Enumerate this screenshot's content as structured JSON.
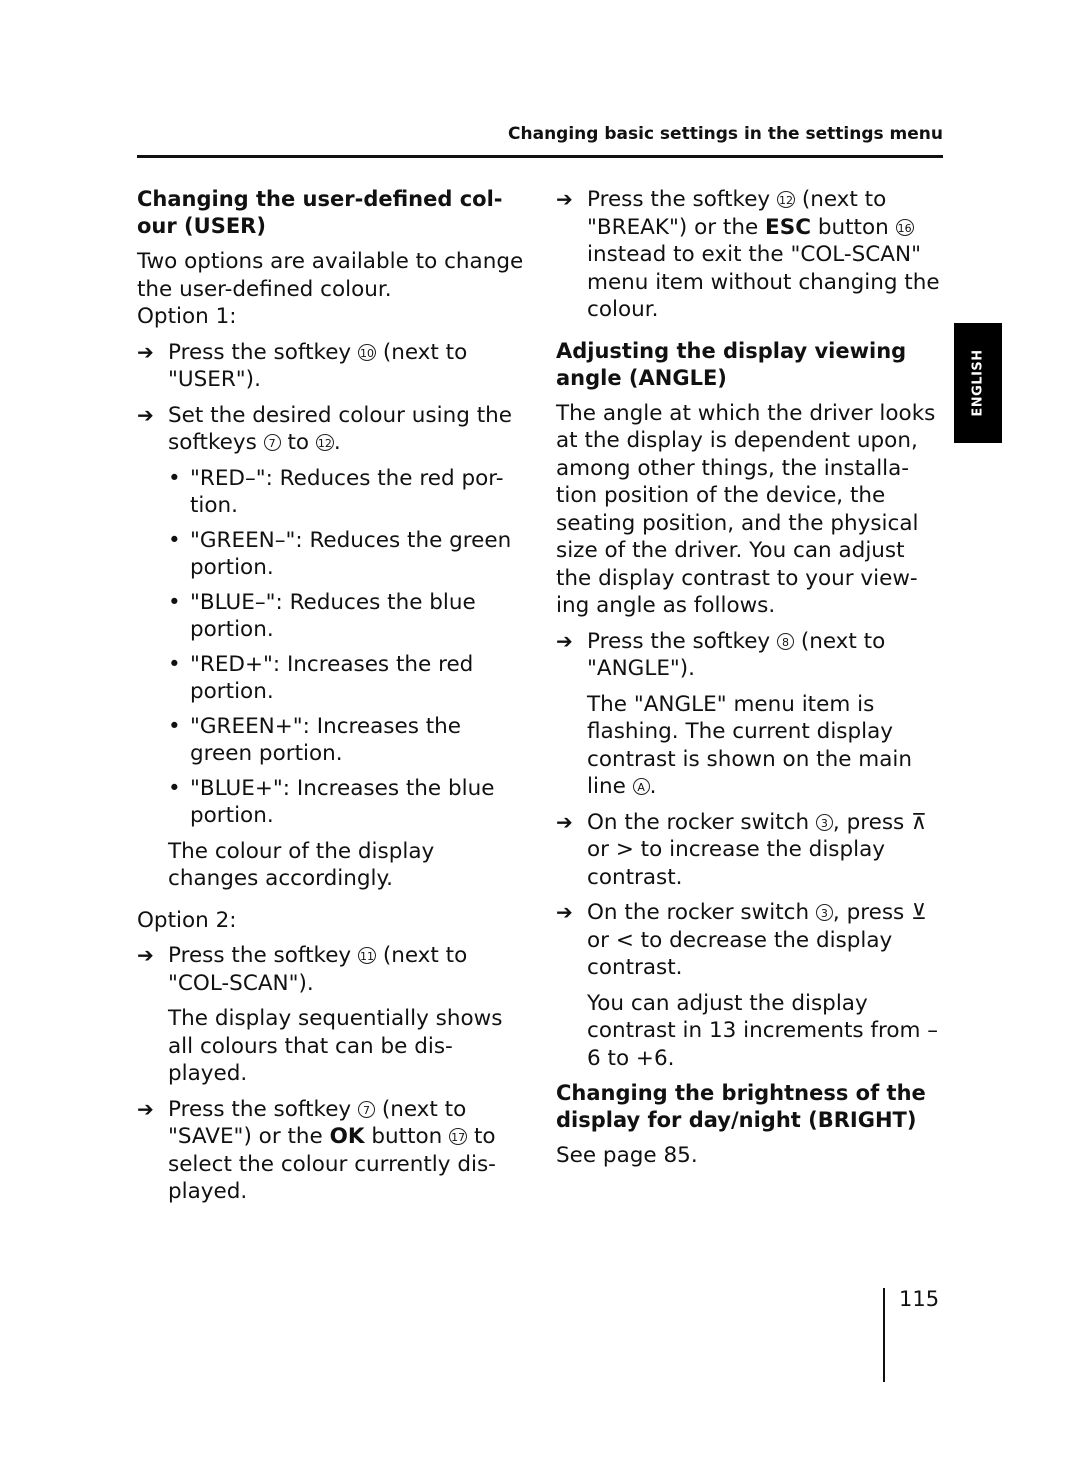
{
  "header": {
    "running_title": "Changing basic settings in the settings menu"
  },
  "side_tab": {
    "label": "ENGLISH"
  },
  "footer": {
    "page_number": "115"
  },
  "left_column": {
    "heading": "Changing the user-defined col- our (USER)",
    "intro": "Two options are available to change the user-defined colour.",
    "option1_label": "Option 1:",
    "step1": {
      "prefix": "Press the softkey ",
      "key": "10",
      "suffix": " (next to \"USER\")."
    },
    "step2": {
      "prefix": "Set the desired colour using the softkeys ",
      "key_from": "7",
      "middle": " to ",
      "key_to": "12",
      "suffix": "."
    },
    "bullets": [
      "\"RED–\": Reduces the red por- tion.",
      "\"GREEN–\": Reduces the green portion.",
      "\"BLUE–\": Reduces the blue portion.",
      "\"RED+\": Increases the red portion.",
      "\"GREEN+\": Increases the green portion.",
      "\"BLUE+\": Increases the blue portion."
    ],
    "result1": "The colour of the display changes accordingly.",
    "option2_label": "Option 2:",
    "step3": {
      "prefix": "Press the softkey ",
      "key": "11",
      "suffix": " (next to \"COL-SCAN\")."
    },
    "result2": "The display sequentially shows all colours that can be dis- played.",
    "step4": {
      "prefix": "Press the softkey ",
      "key": "7",
      "middle": " (next to \"SAVE\") or the ",
      "bold": "OK",
      "middle2": " button ",
      "key2": "17",
      "suffix": " to select the colour currently dis- played."
    }
  },
  "right_column": {
    "step5": {
      "prefix": "Press the softkey ",
      "key": "12",
      "middle": " (next to \"BREAK\") or the ",
      "bold": "ESC",
      "middle2": " button ",
      "key2": "16",
      "suffix": " instead to exit the \"COL-SCAN\" menu item without changing the colour."
    },
    "heading_angle": "Adjusting the display viewing angle (ANGLE)",
    "angle_intro": "The angle at which the driver looks at the display is dependent upon, among other things, the installa- tion position of the device, the seating position, and the physical size of the driver. You can adjust the display contrast to your view- ing angle as follows.",
    "step6": {
      "prefix": "Press the softkey ",
      "key": "8",
      "suffix": " (next to \"ANGLE\")."
    },
    "result3": {
      "prefix": "The \"ANGLE\" menu item is flashing. The current display contrast is shown on the main line ",
      "key": "A",
      "suffix": "."
    },
    "step7": {
      "prefix": "On the rocker switch ",
      "key": "3",
      "middle": ", press ",
      "sym1": "⊼",
      "middle2": " or > to increase the display contrast."
    },
    "step8": {
      "prefix": "On the rocker switch ",
      "key": "3",
      "middle": ", press ",
      "sym1": "⊻",
      "middle2": " or < to decrease the display contrast."
    },
    "result4": "You can adjust the display contrast in 13 increments from –6 to +6.",
    "heading_bright": "Changing the brightness of the display for day/night (BRIGHT)",
    "see_page": "See page 85."
  },
  "icons": {
    "step_arrow": "➔",
    "bullet": "•"
  }
}
